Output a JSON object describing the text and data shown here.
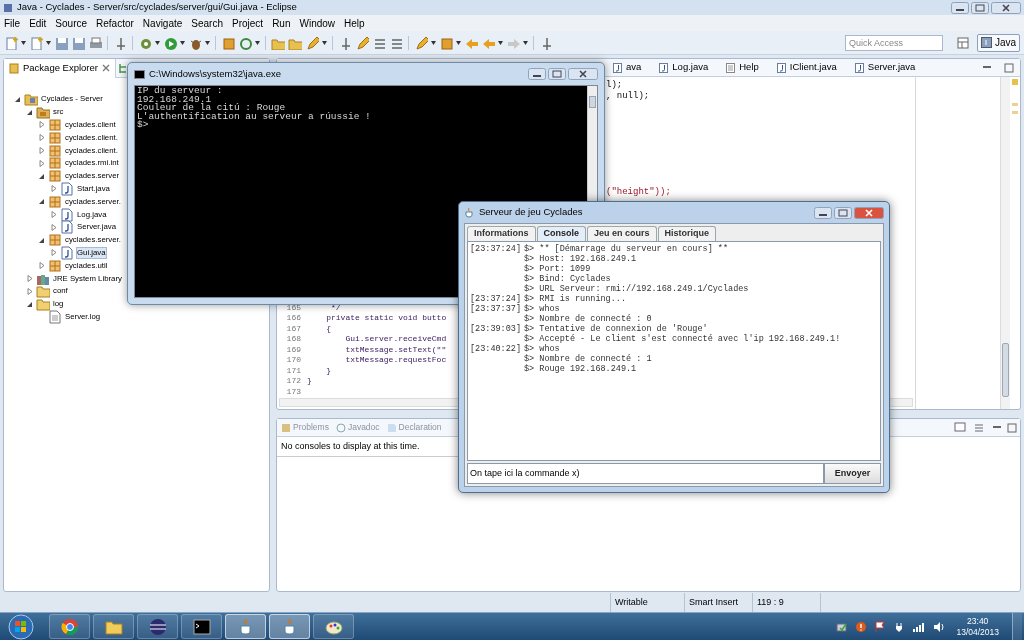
{
  "eclipse": {
    "title": "Java - Cyclades - Server/src/cyclades/server/gui/Gui.java - Eclipse",
    "menu": [
      "File",
      "Edit",
      "Source",
      "Refactor",
      "Navigate",
      "Search",
      "Project",
      "Run",
      "Window",
      "Help"
    ],
    "quick_access": {
      "placeholder": "Quick Access"
    },
    "perspective": {
      "label": "Java",
      "selected": true
    },
    "package_explorer": {
      "title": "Package Explorer",
      "tree": [
        {
          "label": "Cyclades - Server",
          "kind": "project",
          "expanded": true,
          "selected": false,
          "children": [
            {
              "label": "src",
              "kind": "source",
              "expanded": true,
              "selected": false,
              "children": [
                {
                  "label": "cyclades.client",
                  "kind": "package",
                  "expanded": false,
                  "selected": false
                },
                {
                  "label": "cyclades.client.",
                  "kind": "package",
                  "expanded": false,
                  "selected": false
                },
                {
                  "label": "cyclades.client.",
                  "kind": "package",
                  "expanded": false,
                  "selected": false
                },
                {
                  "label": "cyclades.rmi.int",
                  "kind": "package",
                  "expanded": false,
                  "selected": false
                },
                {
                  "label": "cyclades.server",
                  "kind": "package",
                  "expanded": true,
                  "selected": false,
                  "children": [
                    {
                      "label": "Start.java",
                      "kind": "java",
                      "expanded": false,
                      "selected": false
                    }
                  ]
                },
                {
                  "label": "cyclades.server.",
                  "kind": "package",
                  "expanded": true,
                  "selected": false,
                  "children": [
                    {
                      "label": "Log.java",
                      "kind": "java",
                      "expanded": false,
                      "selected": false
                    },
                    {
                      "label": "Server.java",
                      "kind": "java",
                      "expanded": false,
                      "selected": false
                    }
                  ]
                },
                {
                  "label": "cyclades.server.",
                  "kind": "package",
                  "expanded": true,
                  "selected": false,
                  "children": [
                    {
                      "label": "Gui.java",
                      "kind": "java",
                      "expanded": false,
                      "selected": true
                    }
                  ]
                },
                {
                  "label": "cyclades.util",
                  "kind": "package",
                  "expanded": false,
                  "selected": false
                }
              ]
            },
            {
              "label": "JRE System Library",
              "kind": "library",
              "expanded": false,
              "selected": false
            },
            {
              "label": "conf",
              "kind": "folder",
              "expanded": false,
              "selected": false
            },
            {
              "label": "log",
              "kind": "folder",
              "expanded": true,
              "selected": false,
              "children": [
                {
                  "label": "Server.log",
                  "kind": "file",
                  "selected": false
                }
              ]
            }
          ]
        }
      ]
    },
    "editor": {
      "tabs": [
        {
          "label": "ava",
          "kind": "java",
          "selected": false
        },
        {
          "label": "Log.java",
          "kind": "java",
          "selected": false
        },
        {
          "label": "Help",
          "kind": "page",
          "selected": false
        },
        {
          "label": "IClient.java",
          "kind": "java",
          "selected": false
        },
        {
          "label": "Server.java",
          "kind": "java",
          "selected": false
        }
      ],
      "fragments": [
        {
          "text": "l);",
          "kind": "plain"
        },
        {
          "text": ", null);",
          "kind": "plain"
        },
        {
          "text": "(\"height\"));",
          "kind": "string"
        }
      ],
      "lines": [
        {
          "number": "165",
          "text": "     */"
        },
        {
          "number": "166",
          "text": "    private static void butto"
        },
        {
          "number": "167",
          "text": "    {"
        },
        {
          "number": "168",
          "text": "        Gui.server.receiveCmd"
        },
        {
          "number": "169",
          "text": "        txtMessage.setText(\"\""
        },
        {
          "number": "170",
          "text": "        txtMessage.requestFoc"
        },
        {
          "number": "171",
          "text": "    }"
        },
        {
          "number": "172",
          "text": "}"
        },
        {
          "number": "173"
        }
      ]
    },
    "bottom_panel": {
      "tabs": [
        {
          "label": "Problems",
          "selected": false
        },
        {
          "label": "Javadoc",
          "selected": false
        },
        {
          "label": "Declaration",
          "selected": false
        }
      ],
      "message": "No consoles to display at this time."
    },
    "status_bar": [
      "Writable",
      "Smart Insert",
      "119 : 9"
    ]
  },
  "cmd_window": {
    "title": "C:\\Windows\\system32\\java.exe",
    "lines": [
      "IP du serveur :",
      "192.168.249.1",
      "Couleur de la citú : Rouge",
      "L'authentification au serveur a rúussie !",
      "$>"
    ]
  },
  "server_window": {
    "title": "Serveur de jeu Cyclades",
    "tabs": [
      {
        "label": "Informations",
        "selected": false
      },
      {
        "label": "Console",
        "selected": true
      },
      {
        "label": "Jeu en cours",
        "selected": false
      },
      {
        "label": "Historique",
        "selected": false
      }
    ],
    "log": [
      {
        "time": "[23:37:24]",
        "text": "$> ** [Démarrage du serveur en cours] **"
      },
      {
        "text": "$> Host: 192.168.249.1"
      },
      {
        "text": "$> Port: 1099"
      },
      {
        "text": "$> Bind: Cyclades"
      },
      {
        "text": "$> URL Serveur: rmi://192.168.249.1/Cyclades"
      },
      {
        "time": "[23:37:24]",
        "text": "$> RMI is running..."
      },
      {
        "time": "[23:37:37]",
        "text": "$> whos"
      },
      {
        "text": "$> Nombre de connecté : 0"
      },
      {
        "time": "[23:39:03]",
        "text": "$> Tentative de connexion de 'Rouge'"
      },
      {
        "text": "$> Accepté - Le client s'est connecté avec l'ip 192.168.249.1!"
      },
      {
        "time": "[23:40:22]",
        "text": "$> whos"
      },
      {
        "text": "$> Nombre de connecté : 1"
      },
      {
        "text": "$> Rouge 192.168.249.1"
      }
    ],
    "command": {
      "value": "On tape ici la commande x)"
    },
    "send_button": "Envoyer"
  },
  "taskbar": {
    "apps": [
      {
        "kind": "browser",
        "active": false
      },
      {
        "kind": "folder",
        "active": false
      },
      {
        "kind": "sphere",
        "active": false
      },
      {
        "kind": "terminal",
        "active": false
      },
      {
        "kind": "cup",
        "active": true
      },
      {
        "kind": "cup",
        "active": true
      },
      {
        "kind": "palette",
        "active": false
      }
    ],
    "clock": {
      "time": "23:40",
      "date": "13/04/2013"
    }
  }
}
